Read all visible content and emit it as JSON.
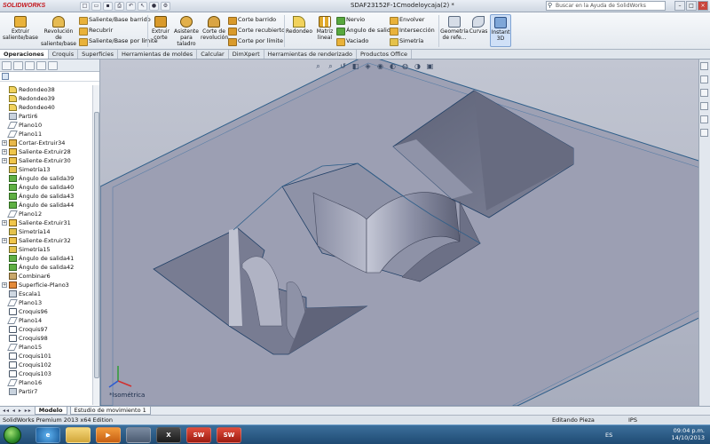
{
  "app": {
    "logo": "SOLIDWORKS",
    "document_title": "SDAF23152F-1Cmodeloycaja(2) *",
    "search_placeholder": "Buscar en la Ayuda de SolidWorks"
  },
  "ribbon": {
    "extrude_boss": "Extruir saliente/base",
    "revolve_boss": "Revolución de saliente/base",
    "swept_boss": "Saliente/Base barrido",
    "wrap": "Recubrir",
    "boundary_boss": "Saliente/Base por límite",
    "extrude_cut": "Extruir corte",
    "hole_wizard": "Asistente para taladro",
    "revolve_cut": "Corte de revolución",
    "swept_cut": "Corte barrido",
    "lofted_cut": "Corte recubierto",
    "boundary_cut": "Corte por límite",
    "fillet": "Redondeo",
    "linear_pattern": "Matriz lineal",
    "rib": "Nervio",
    "draft": "Ángulo de salida",
    "shell": "Vaciado",
    "wrap_feature": "Envolver",
    "intersect": "Intersección",
    "mirror": "Simetría",
    "reference_geometry": "Geometría de refe...",
    "curves": "Curvas",
    "instant3d": "Instant 3D"
  },
  "command_tabs": [
    "Operaciones",
    "Croquis",
    "Superficies",
    "Herramientas de moldes",
    "Calcular",
    "DimXpert",
    "Herramientas de renderizado",
    "Productos Office"
  ],
  "feature_tree": [
    {
      "label": "Redondeo38",
      "icon": "fillet",
      "expand": false
    },
    {
      "label": "Redondeo39",
      "icon": "fillet",
      "expand": false
    },
    {
      "label": "Redondeo40",
      "icon": "fillet",
      "expand": false
    },
    {
      "label": "Partir6",
      "icon": "part",
      "expand": false
    },
    {
      "label": "Plano10",
      "icon": "plane",
      "expand": false
    },
    {
      "label": "Plano11",
      "icon": "plane",
      "expand": false
    },
    {
      "label": "Cortar-Extruir34",
      "icon": "cut",
      "expand": true
    },
    {
      "label": "Saliente-Extruir28",
      "icon": "boss",
      "expand": true
    },
    {
      "label": "Saliente-Extruir30",
      "icon": "boss",
      "expand": true
    },
    {
      "label": "Simetría13",
      "icon": "mirror",
      "expand": false
    },
    {
      "label": "Ángulo de salida39",
      "icon": "draft",
      "expand": false
    },
    {
      "label": "Ángulo de salida40",
      "icon": "draft",
      "expand": false
    },
    {
      "label": "Ángulo de salida43",
      "icon": "draft",
      "expand": false
    },
    {
      "label": "Ángulo de salida44",
      "icon": "draft",
      "expand": false
    },
    {
      "label": "Plano12",
      "icon": "plane",
      "expand": false
    },
    {
      "label": "Saliente-Extruir31",
      "icon": "boss",
      "expand": true
    },
    {
      "label": "Simetría14",
      "icon": "mirror",
      "expand": false
    },
    {
      "label": "Saliente-Extruir32",
      "icon": "boss",
      "expand": true
    },
    {
      "label": "Simetría15",
      "icon": "mirror",
      "expand": false
    },
    {
      "label": "Ángulo de salida41",
      "icon": "draft",
      "expand": false
    },
    {
      "label": "Ángulo de salida42",
      "icon": "draft",
      "expand": false
    },
    {
      "label": "Combinar6",
      "icon": "combine",
      "expand": false
    },
    {
      "label": "Superficie-Plano3",
      "icon": "surface",
      "expand": true
    },
    {
      "label": "Escala1",
      "icon": "scale",
      "expand": false
    },
    {
      "label": "Plano13",
      "icon": "plane",
      "expand": false
    },
    {
      "label": "Croquis96",
      "icon": "sketch",
      "expand": false
    },
    {
      "label": "Plano14",
      "icon": "plane",
      "expand": false
    },
    {
      "label": "Croquis97",
      "icon": "sketch",
      "expand": false
    },
    {
      "label": "Croquis98",
      "icon": "sketch",
      "expand": false
    },
    {
      "label": "Plano15",
      "icon": "plane",
      "expand": false
    },
    {
      "label": "Croquis101",
      "icon": "sketch",
      "expand": false
    },
    {
      "label": "Croquis102",
      "icon": "sketch",
      "expand": false
    },
    {
      "label": "Croquis103",
      "icon": "sketch",
      "expand": false
    },
    {
      "label": "Plano16",
      "icon": "plane",
      "expand": false
    },
    {
      "label": "Partir7",
      "icon": "part",
      "expand": false
    }
  ],
  "graphics": {
    "view_name": "*Isométrica"
  },
  "bottom_tabs": {
    "model": "Modelo",
    "motion_study": "Estudio de movimiento 1"
  },
  "status": {
    "edition": "SolidWorks Premium 2013 x64 Edition",
    "mode": "Editando Pieza",
    "units": "IPS"
  },
  "taskbar": {
    "language": "ES",
    "time": "09:04 p.m.",
    "date": "14/10/2013"
  },
  "colors": {
    "solidworks_red": "#c4161c",
    "model_gray": "#9ea1b4",
    "background": "#b4b8c6"
  }
}
